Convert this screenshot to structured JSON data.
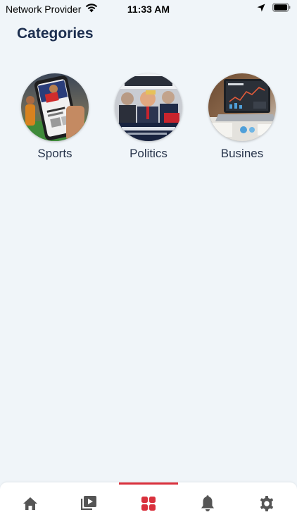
{
  "status_bar": {
    "carrier": "Network Provider",
    "time": "11:33 AM"
  },
  "page": {
    "title": "Categories"
  },
  "categories": [
    {
      "label": "Sports"
    },
    {
      "label": "Politics"
    },
    {
      "label": "Busines"
    }
  ],
  "tab_bar": {
    "active_tab": "categories",
    "accent": "#d9303c",
    "icon_color": "#555555",
    "tabs": [
      {
        "id": "home",
        "icon": "home-icon"
      },
      {
        "id": "videos",
        "icon": "video-library-icon"
      },
      {
        "id": "categories",
        "icon": "grid-icon"
      },
      {
        "id": "notifications",
        "icon": "bell-icon"
      },
      {
        "id": "settings",
        "icon": "gear-icon"
      }
    ]
  }
}
